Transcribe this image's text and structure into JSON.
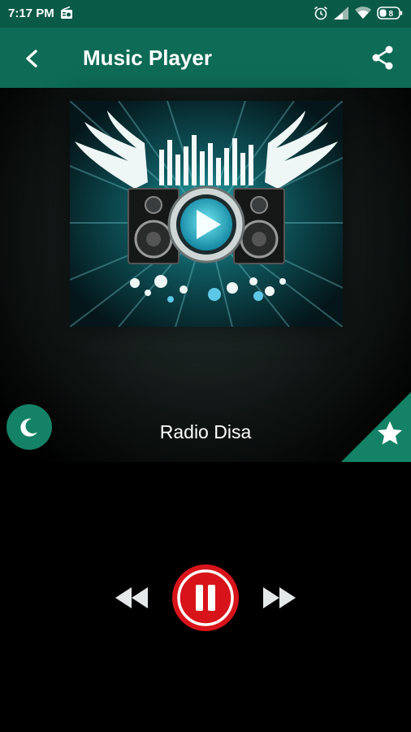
{
  "status_bar": {
    "time": "7:17 PM",
    "icons": [
      "radio-icon",
      "alarm-icon",
      "signal-icon",
      "wifi-icon",
      "battery-icon"
    ],
    "battery_level": "8"
  },
  "app_bar": {
    "title": "Music Player",
    "back_icon": "chevron-left-icon",
    "share_icon": "share-icon",
    "color": "#0d6b56"
  },
  "player": {
    "station_name": "Radio Disa",
    "artwork_icon": "music-speakers-artwork",
    "sleep_icon": "moon-icon",
    "favorite_icon": "star-icon",
    "accent_color": "#138266"
  },
  "controls": {
    "rewind_icon": "rewind-icon",
    "pause_icon": "pause-icon",
    "forward_icon": "fast-forward-icon",
    "pause_color": "#d8141a"
  }
}
